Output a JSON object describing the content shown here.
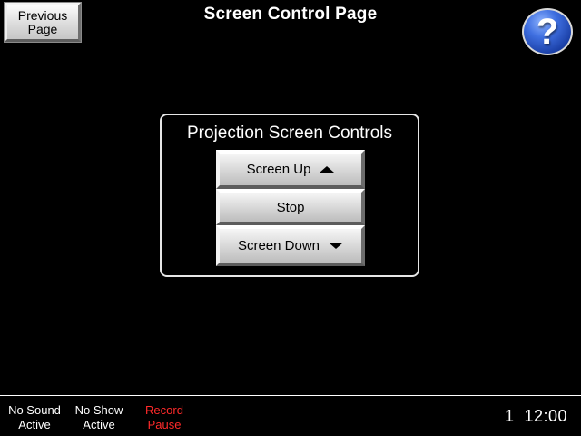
{
  "header": {
    "previous_line1": "Previous",
    "previous_line2": "Page",
    "title": "Screen Control Page",
    "help_label": "?"
  },
  "panel": {
    "title": "Projection Screen Controls",
    "buttons": [
      {
        "label": "Screen Up",
        "icon": "triangle-up-icon"
      },
      {
        "label": "Stop"
      },
      {
        "label": "Screen Down",
        "icon": "triangle-down-icon"
      }
    ]
  },
  "status_bar": {
    "items": [
      {
        "line1": "No Sound",
        "line2": "Active",
        "color": "#ffffff"
      },
      {
        "line1": "No Show",
        "line2": "Active",
        "color": "#ffffff"
      },
      {
        "line1": "Record",
        "line2": "Pause",
        "color": "#ff2a2a"
      }
    ],
    "clock": "1  12:00"
  }
}
